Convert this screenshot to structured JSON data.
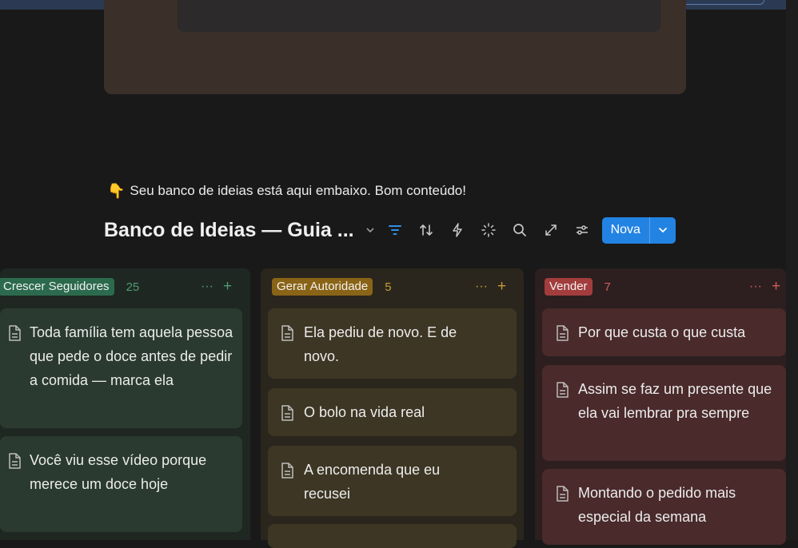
{
  "banner": {
    "emoji": "👇",
    "text": "Seu banco de ideias está aqui embaixo. Bom conteúdo!"
  },
  "database": {
    "title": "Banco de Ideias — Guia ...",
    "new_button": "Nova",
    "tools": [
      "chevron-down-icon",
      "filter-icon",
      "sort-icon",
      "automation-icon",
      "ai-sparkle-icon",
      "search-icon",
      "expand-icon",
      "settings-sliders-icon"
    ]
  },
  "colors": {
    "accent": "#2383e2",
    "green_tag": "#2c6a4d",
    "yellow_tag": "#8a6416",
    "red_tag": "#a33d3d"
  },
  "columns": [
    {
      "name": "Crescer Seguidores",
      "count": "25",
      "cards": [
        {
          "title": "Toda família tem aquela pessoa que pede o doce antes de pedir a comida — marca ela"
        },
        {
          "title": "Você viu esse vídeo porque merece um doce hoje"
        }
      ]
    },
    {
      "name": "Gerar Autoridade",
      "count": "5",
      "cards": [
        {
          "title": "Ela pediu de novo. E de novo."
        },
        {
          "title": "O bolo na vida real"
        },
        {
          "title": "A encomenda que eu recusei"
        }
      ]
    },
    {
      "name": "Vender",
      "count": "7",
      "cards": [
        {
          "title": "Por que custa o que custa"
        },
        {
          "title": "Assim se faz um presente que ela vai lembrar pra sempre"
        },
        {
          "title": "Montando o pedido mais especial da semana"
        }
      ]
    }
  ],
  "column_actions": {
    "more": "···",
    "add": "+"
  }
}
